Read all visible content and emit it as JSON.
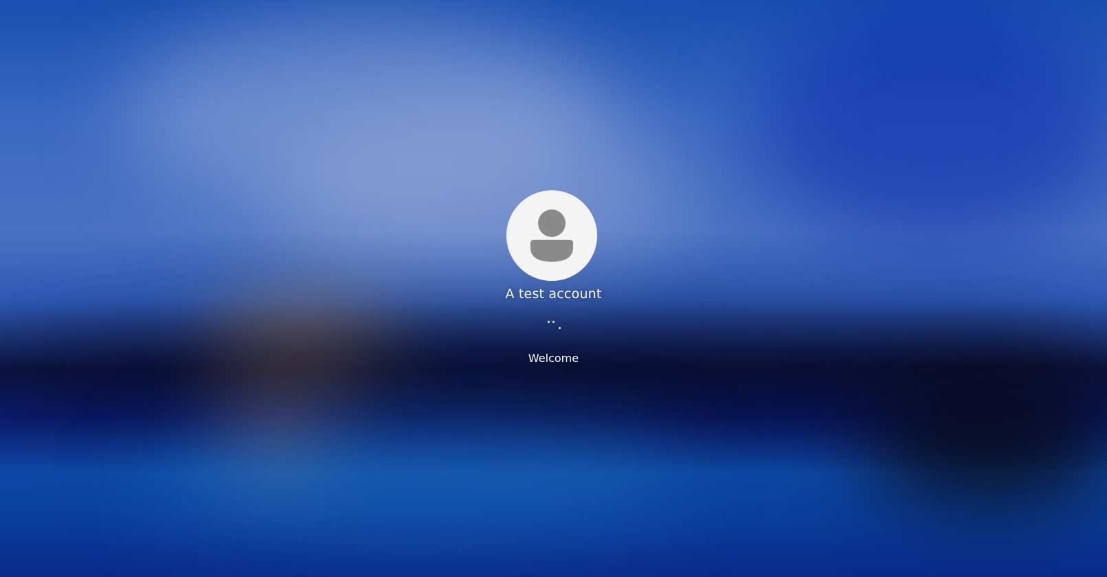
{
  "login": {
    "account_name": "A test account",
    "status": "Welcome"
  },
  "avatar": {
    "icon": "user-silhouette-icon",
    "background_color": "#f4f4f4",
    "figure_color": "#8a8a8a"
  },
  "spinner": {
    "icon": "loading-spinner-icon",
    "color": "#ffffff"
  }
}
